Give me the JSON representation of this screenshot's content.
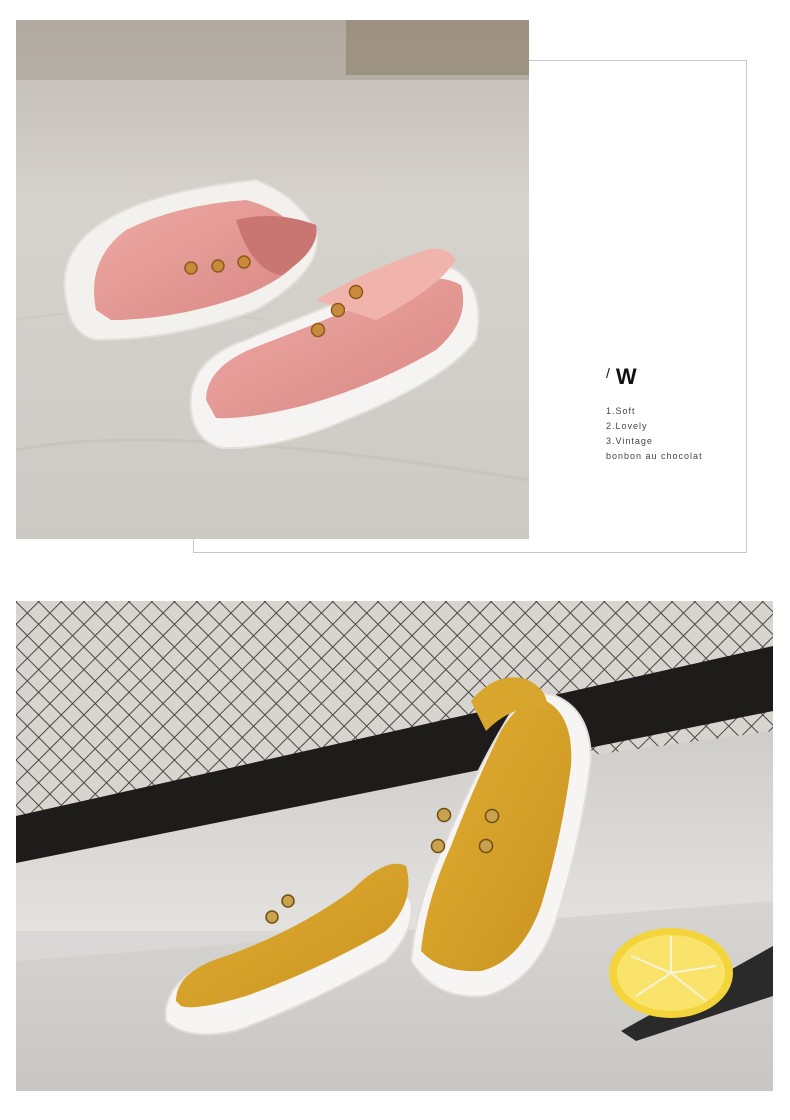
{
  "caption": {
    "slash": "/",
    "title": "W",
    "features": [
      "1.Soft",
      "2.Lovely",
      "3.Vintage"
    ],
    "tagline": "bonbon au chocolat"
  },
  "photos": {
    "top": {
      "subject": "pink-slip-on-sneakers",
      "accent": "#e59c99"
    },
    "bottom": {
      "subject": "yellow-slip-on-sneakers",
      "accent": "#d9a52a"
    }
  }
}
